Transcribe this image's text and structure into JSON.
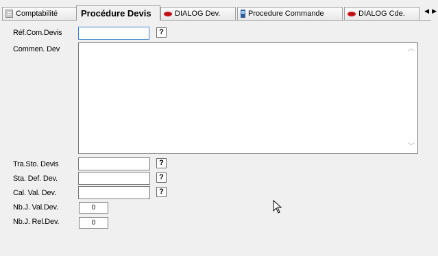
{
  "tabs": [
    {
      "label": "Comptabilité",
      "icon": "ledger-icon"
    },
    {
      "label": "Procédure Devis",
      "icon": null,
      "active": true
    },
    {
      "label": "DIALOG Dev.",
      "icon": "lips-icon"
    },
    {
      "label": "Procedure Commande",
      "icon": "phone-icon"
    },
    {
      "label": "DIALOG Cde.",
      "icon": "lips-icon"
    }
  ],
  "tab_scroll": {
    "left": "◀",
    "right": "▶"
  },
  "fields": {
    "ref_com_devis": {
      "label": "Réf.Com.Devis",
      "value": "",
      "help": "?"
    },
    "commen_dev": {
      "label": "Commen. Dev",
      "value": ""
    },
    "tra_sto_devis": {
      "label": "Tra.Sto. Devis",
      "value": "",
      "help": "?"
    },
    "sta_def_dev": {
      "label": "Sta. Def. Dev.",
      "value": "",
      "help": "?"
    },
    "cal_val_dev": {
      "label": "Cal. Val. Dev.",
      "value": "",
      "help": "?"
    },
    "nbj_val_dev": {
      "label": "Nb.J. Val.Dev.",
      "value": "0"
    },
    "nbj_rel_dev": {
      "label": "Nb.J. Rel.Dev.",
      "value": "0"
    }
  },
  "memo_scroll": {
    "up": "︿",
    "down": "﹀"
  }
}
